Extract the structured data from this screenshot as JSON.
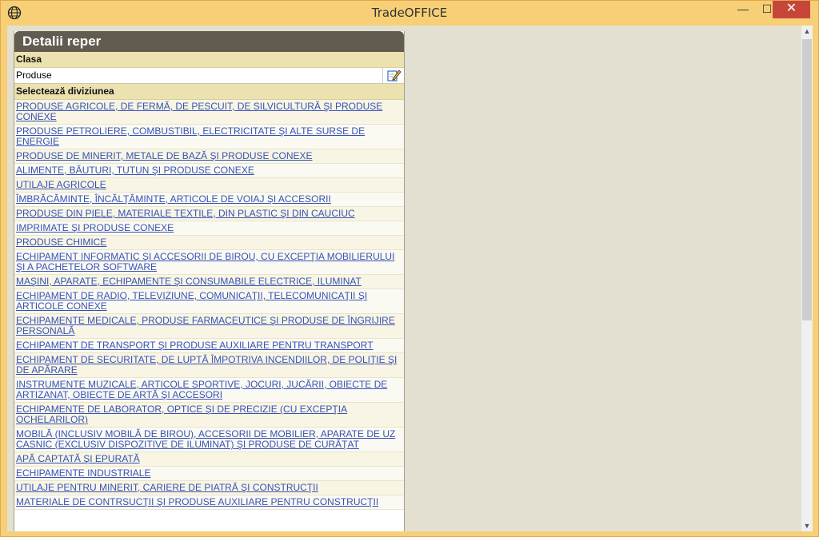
{
  "window": {
    "title": "TradeOFFICE",
    "icons": {
      "app": "globe-icon",
      "minimize": "minimize-icon",
      "maximize": "maximize-icon",
      "close": "close-icon"
    },
    "controls": {
      "minimize": "—",
      "maximize": "☐",
      "close": "✕"
    }
  },
  "panel": {
    "title": "Detalii reper",
    "class_header": "Clasa",
    "class_value": "Produse",
    "edit_icon": "edit-icon",
    "division_header": "Selectează diviziunea",
    "divisions": [
      "PRODUSE AGRICOLE, DE FERMĂ, DE PESCUIT, DE SILVICULTURĂ ŞI PRODUSE CONEXE",
      "PRODUSE PETROLIERE, COMBUSTIBIL, ELECTRICITATE ŞI ALTE SURSE DE ENERGIE",
      "PRODUSE DE MINERIT, METALE DE BAZĂ ŞI PRODUSE CONEXE",
      "ALIMENTE, BĂUTURI, TUTUN ŞI PRODUSE CONEXE",
      "UTILAJE AGRICOLE",
      "ÎMBRĂCĂMINTE, ÎNCĂLŢĂMINTE, ARTICOLE DE VOIAJ ŞI ACCESORII",
      "PRODUSE DIN PIELE, MATERIALE TEXTILE, DIN PLASTIC ŞI DIN CAUCIUC",
      "IMPRIMATE ŞI PRODUSE CONEXE",
      "PRODUSE CHIMICE",
      "ECHIPAMENT INFORMATIC ŞI ACCESORII DE BIROU, CU EXCEPŢIA MOBILIERULUI ŞI A PACHETELOR SOFTWARE",
      "MAŞINI, APARATE, ECHIPAMENTE ŞI CONSUMABILE ELECTRICE, ILUMINAT",
      "ECHIPAMENT DE RADIO, TELEVIZIUNE, COMUNICAŢII, TELECOMUNICAŢII ŞI ARTICOLE CONEXE",
      "ECHIPAMENTE MEDICALE, PRODUSE FARMACEUTICE ŞI PRODUSE DE ÎNGRIJIRE PERSONALĂ",
      "ECHIPAMENT DE TRANSPORT ŞI PRODUSE AUXILIARE PENTRU TRANSPORT",
      "ECHIPAMENT DE SECURITATE, DE LUPTĂ ÎMPOTRIVA INCENDIILOR, DE POLIŢIE ŞI DE APĂRARE",
      "INSTRUMENTE MUZICALE, ARTICOLE SPORTIVE, JOCURI, JUCĂRII, OBIECTE DE ARTIZANAT, OBIECTE DE ARTĂ ŞI ACCESORI",
      "ECHIPAMENTE DE LABORATOR, OPTICE ŞI DE PRECIZIE (CU EXCEPŢIA OCHELARILOR)",
      "MOBILĂ (INCLUSIV MOBILĂ DE BIROU), ACCESORII DE MOBILIER, APARATE DE UZ CASNIC (EXCLUSIV DISPOZITIVE DE ILUMINAT) ŞI PRODUSE DE CURĂŢAT",
      "APĂ CAPTATĂ ŞI EPURATĂ",
      "ECHIPAMENTE INDUSTRIALE",
      "UTILAJE PENTRU MINERIT, CARIERE DE PIATRĂ ŞI CONSTRUCŢII",
      "MATERIALE DE CONTRSUCŢII ŞI PRODUSE AUXILIARE PENTRU CONSTRUCŢII"
    ]
  },
  "scrollbar": {
    "up": "▲",
    "down": "▼"
  }
}
